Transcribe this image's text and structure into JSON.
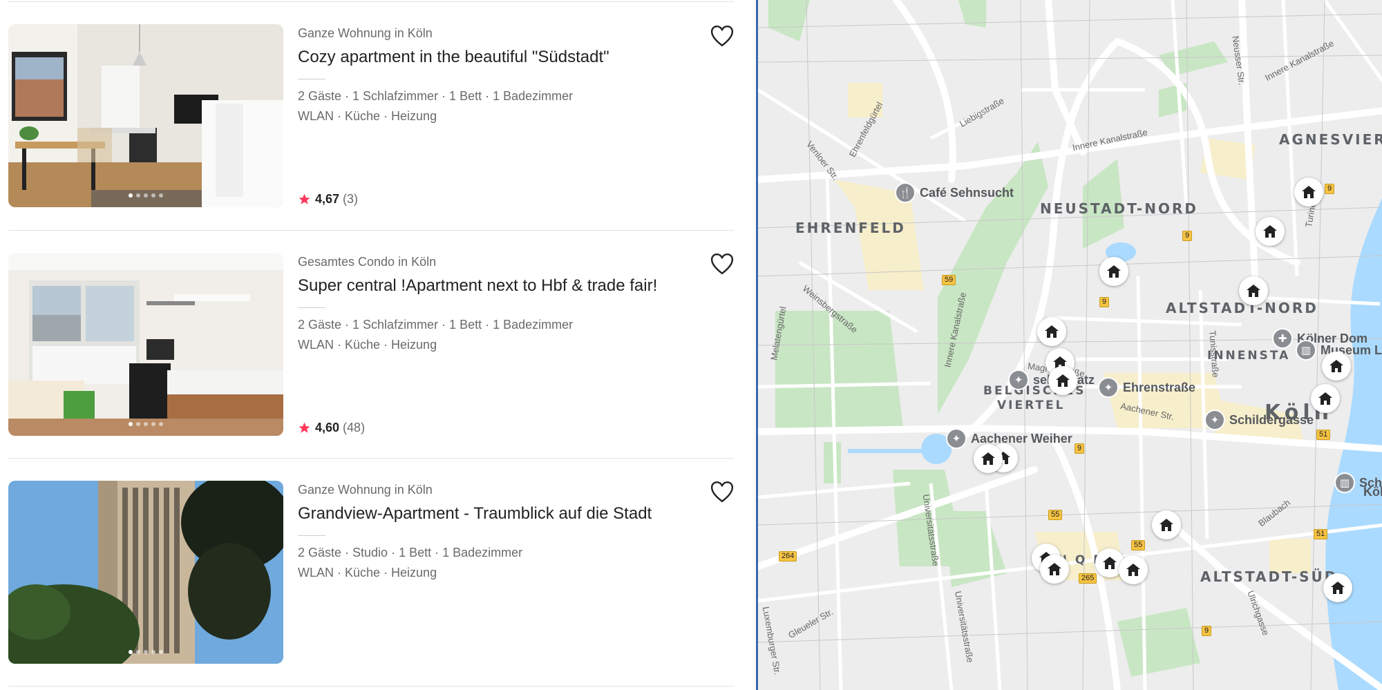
{
  "listings": [
    {
      "type": "Ganze Wohnung in Köln",
      "title": "Cozy apartment in the beautiful \"Südstadt\"",
      "meta": "2 Gäste · 1 Schlafzimmer · 1 Bett · 1 Badezimmer",
      "amenities": "WLAN · Küche · Heizung",
      "rating": "4,67",
      "reviews": "(3)"
    },
    {
      "type": "Gesamtes Condo in Köln",
      "title": "Super central !Apartment next to Hbf & trade fair!",
      "meta": "2 Gäste · 1 Schlafzimmer · 1 Bett · 1 Badezimmer",
      "amenities": "WLAN · Küche · Heizung",
      "rating": "4,60",
      "reviews": "(48)"
    },
    {
      "type": "Ganze Wohnung in Köln",
      "title": "Grandview-Apartment - Traumblick auf die Stadt",
      "meta": "2 Gäste · Studio · 1 Bett · 1 Badezimmer",
      "amenities": "WLAN · Küche · Heizung"
    }
  ],
  "map": {
    "districts": {
      "ehrenfeld": "EHRENFELD",
      "neustadt_nord": "NEUSTADT-NORD",
      "altstadt_nord": "ALTSTADT-NORD",
      "agnesviertel": "AGNESVIERT",
      "innenstadt": "INNENSTA",
      "belgisches_1": "BELGISCHES",
      "belgisches_2": "VIERTEL",
      "koeln": "Köln",
      "altstadt_sued": "ALTSTADT-SÜD",
      "quartier": "L N Q   ER"
    },
    "pois": {
      "cafe": "Café Sehnsucht",
      "dom": "Kölner Dom",
      "museum": "Museum Lu",
      "ehrenstrasse": "Ehrenstraße",
      "schildergasse": "Schildergasse",
      "aachener": "Aachener Weiher",
      "rudolf": "seler Platz",
      "sch": "Sch",
      "koel": "Köln"
    },
    "streets": {
      "venloer": "Venloer Str.",
      "ehrenfeldguertel": "Ehrenfeldgürtel",
      "liebigstr": "Liebigstraße",
      "innere_kanal": "Innere Kanalstraße",
      "innere_kanal2": "Innere Kanalstraße",
      "weinsberg": "Weinsbergstraße",
      "melaten": "Melatengürtel",
      "innere_kanal3": "Innere Kanalstraße",
      "magnus": "Magnusstraße",
      "tunis": "Tunisstraße",
      "turiner": "Turiner Str.",
      "neusser": "Neusser Str.",
      "aachener_str": "Aachener Str.",
      "universitaet": "Universitätsstraße",
      "universitaet2": "Universitätsstraße",
      "luxemburger": "Luxemburger Str.",
      "gleueler": "Gleueler Str.",
      "ulrich": "Ulrichgasse",
      "blaubach": "Blaubach"
    },
    "road_numbers": [
      "59",
      "9",
      "9",
      "9",
      "51",
      "9",
      "55",
      "55",
      "51",
      "264",
      "265",
      "9",
      "51"
    ]
  },
  "colors": {
    "star": "#ff385c",
    "map_bg": "#ededed",
    "park": "#c8e6c3",
    "water": "#aadaff"
  }
}
